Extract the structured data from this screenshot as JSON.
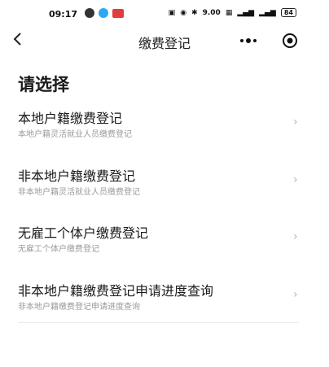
{
  "status_bar": {
    "time": "09:17",
    "speed": "9.00\nKB/S",
    "battery": "84"
  },
  "nav": {
    "back_icon": "<",
    "title": "缴费登记"
  },
  "main": {
    "heading": "请选择",
    "items": [
      {
        "label": "本地户籍缴费登记",
        "sub": "本地户籍灵活就业人员缴费登记"
      },
      {
        "label": "非本地户籍缴费登记",
        "sub": "非本地户籍灵活就业人员缴费登记"
      },
      {
        "label": "无雇工个体户缴费登记",
        "sub": "无雇工个体户缴费登记"
      },
      {
        "label": "非本地户籍缴费登记申请进度查询",
        "sub": "非本地户籍缴费登记申请进度查询"
      }
    ],
    "chevron": "›"
  }
}
